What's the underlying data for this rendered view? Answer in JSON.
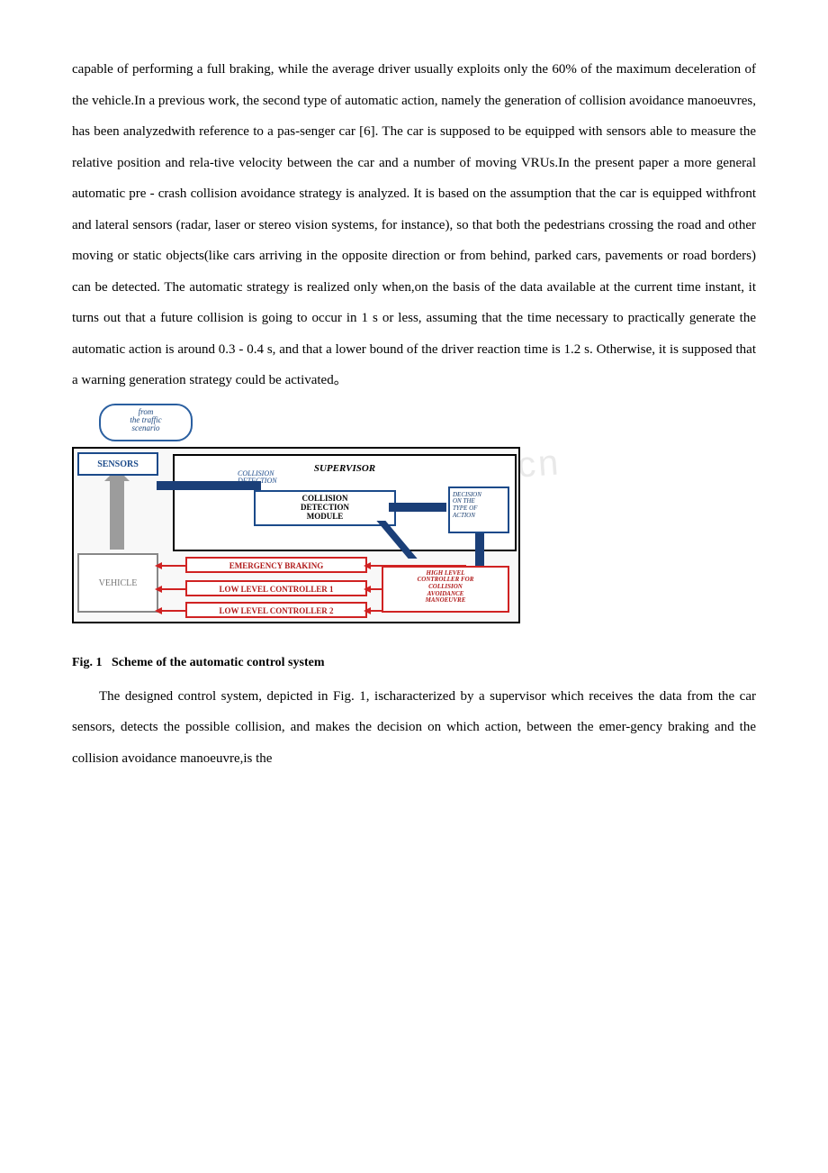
{
  "paragraph1": "capable of performing a full braking, while the average driver usually exploits only the 60% of the maximum deceleration of the vehicle.In a previous work, the second type of automatic action, namely the generation of collision avoidance manoeuvres, has been analyzedwith reference to a pas-senger car [6]. The car is supposed to be equipped with sensors able to measure the relative position and rela-tive velocity between the car and a number of moving VRUs.In the present paper a more general automatic pre - crash collision avoidance strategy is analyzed. It is based on the assumption that the car is equipped withfront and lateral sensors (radar, laser or stereo vision systems, for instance), so that both the pedestrians crossing the road and other moving or static objects(like cars arriving in the opposite direction or from behind, parked cars, pavements or road borders) can be detected. The automatic strategy is realized only when,on the basis of the data available at the current time instant, it turns out that a future collision is going to occur in 1 s or less, assuming that the time necessary to practically generate the automatic action is around 0.3 - 0.4 s, and that a lower bound of the driver reaction time is 1.2 s. Otherwise, it is supposed that a warning generation strategy could be activated。",
  "watermark": "www.zixin.com.cn",
  "fig": {
    "scenario": "from\nthe traffic\nscenario",
    "sensors": "SENSORS",
    "supervisor": "SUPERVISOR",
    "cdu": "COLLISION\nDETECTION\nUNIT",
    "cdm": "COLLISION\nDETECTION\nMODULE",
    "decision": "DECISION\nON THE\nTYPE OF\nACTION",
    "vehicle": "VEHICLE",
    "eb": "EMERGENCY BRAKING",
    "llc1": "LOW LEVEL CONTROLLER 1",
    "llc2": "LOW LEVEL CONTROLLER 2",
    "highctl": "HIGH LEVEL\nCONTROLLER FOR\nCOLLISION\nAVOIDANCE\nMANOEUVRE",
    "caption_label": "Fig. 1",
    "caption_text": "Scheme of the automatic control system"
  },
  "paragraph2": "The designed control system, depicted in Fig. 1, ischaracterized by a supervisor which receives the data from the car sensors, detects the possible collision, and makes the decision on which action, between the emer-gency braking and the collision avoidance manoeuvre,is the"
}
